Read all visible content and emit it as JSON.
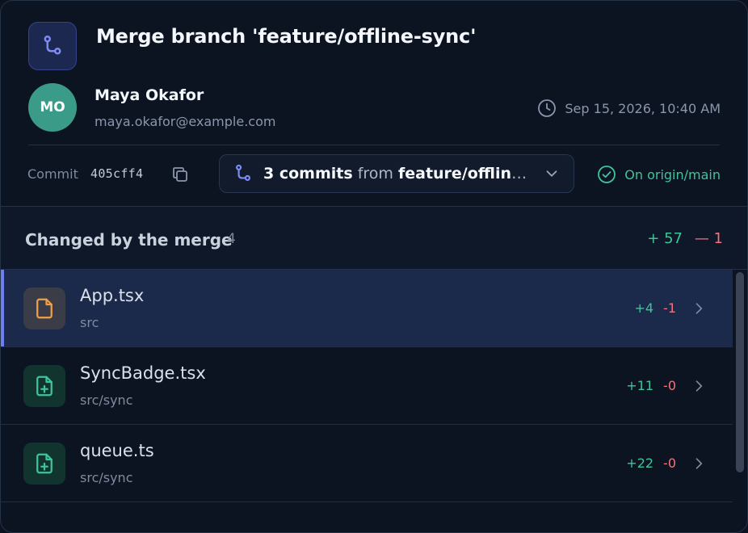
{
  "header": {
    "title": "Merge branch 'feature/offline-sync'",
    "icon": "git-merge-icon"
  },
  "author": {
    "initials": "MO",
    "name": "Maya Okafor",
    "email": "maya.okafor@example.com",
    "avatar_color": "#3a9c88"
  },
  "timestamp": "Sep 15, 2026, 10:40 AM",
  "commit": {
    "label": "Commit",
    "hash": "405cff4"
  },
  "commits_dropdown": {
    "count_text": "3 commits",
    "from_text": "from",
    "branch": "feature/offline-sync"
  },
  "origin_status": "On origin/main",
  "changes": {
    "title": "Changed by the merge",
    "count": "4",
    "total_additions": "57",
    "total_deletions": "1"
  },
  "files": [
    {
      "name": "App.tsx",
      "path": "src",
      "additions": "+4",
      "deletions": "-1",
      "status": "modified",
      "selected": true
    },
    {
      "name": "SyncBadge.tsx",
      "path": "src/sync",
      "additions": "+11",
      "deletions": "-0",
      "status": "added",
      "selected": false
    },
    {
      "name": "queue.ts",
      "path": "src/sync",
      "additions": "+22",
      "deletions": "-0",
      "status": "added",
      "selected": false
    }
  ],
  "colors": {
    "accent": "#6b7ff0",
    "addition": "#3fc49a",
    "deletion": "#f0737d",
    "modified_icon": "#f0a04b"
  }
}
